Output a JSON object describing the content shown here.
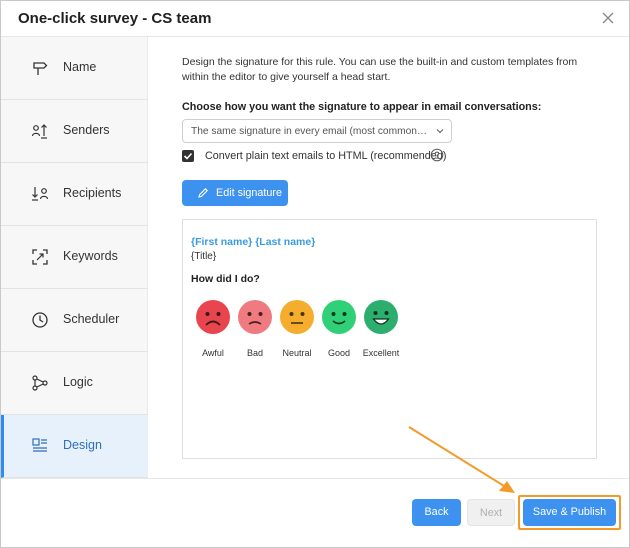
{
  "window": {
    "title": "One-click survey - CS team"
  },
  "sidebar": {
    "items": [
      {
        "label": "Name",
        "icon": "signpost-icon"
      },
      {
        "label": "Senders",
        "icon": "senders-icon"
      },
      {
        "label": "Recipients",
        "icon": "recipients-icon"
      },
      {
        "label": "Keywords",
        "icon": "keywords-icon"
      },
      {
        "label": "Scheduler",
        "icon": "clock-icon"
      },
      {
        "label": "Logic",
        "icon": "logic-icon"
      },
      {
        "label": "Design",
        "icon": "design-icon",
        "active": true
      }
    ]
  },
  "main": {
    "description": "Design the signature for this rule. You can use the built-in and custom templates from within the editor to give yourself a head start.",
    "choose_label": "Choose how you want the signature to appear in email conversations:",
    "select_value": "The same signature in every email (most common scenario)",
    "convert_label": "Convert plain text emails to HTML (recommended)",
    "convert_checked": true,
    "edit_button": "Edit signature",
    "preview": {
      "name": "{First name} {Last name}",
      "title": "{Title}",
      "question": "How did I do?",
      "ratings": [
        {
          "label": "Awful",
          "color": "#e8454f"
        },
        {
          "label": "Bad",
          "color": "#ef7b80"
        },
        {
          "label": "Neutral",
          "color": "#f4ad2c"
        },
        {
          "label": "Good",
          "color": "#2fd078"
        },
        {
          "label": "Excellent",
          "color": "#2cae6e"
        }
      ]
    }
  },
  "footer": {
    "back": "Back",
    "next": "Next",
    "save": "Save & Publish"
  },
  "colors": {
    "accent": "#3d92ef",
    "highlight": "#f39a2a",
    "sidebar_active": "#e6f1fc"
  }
}
